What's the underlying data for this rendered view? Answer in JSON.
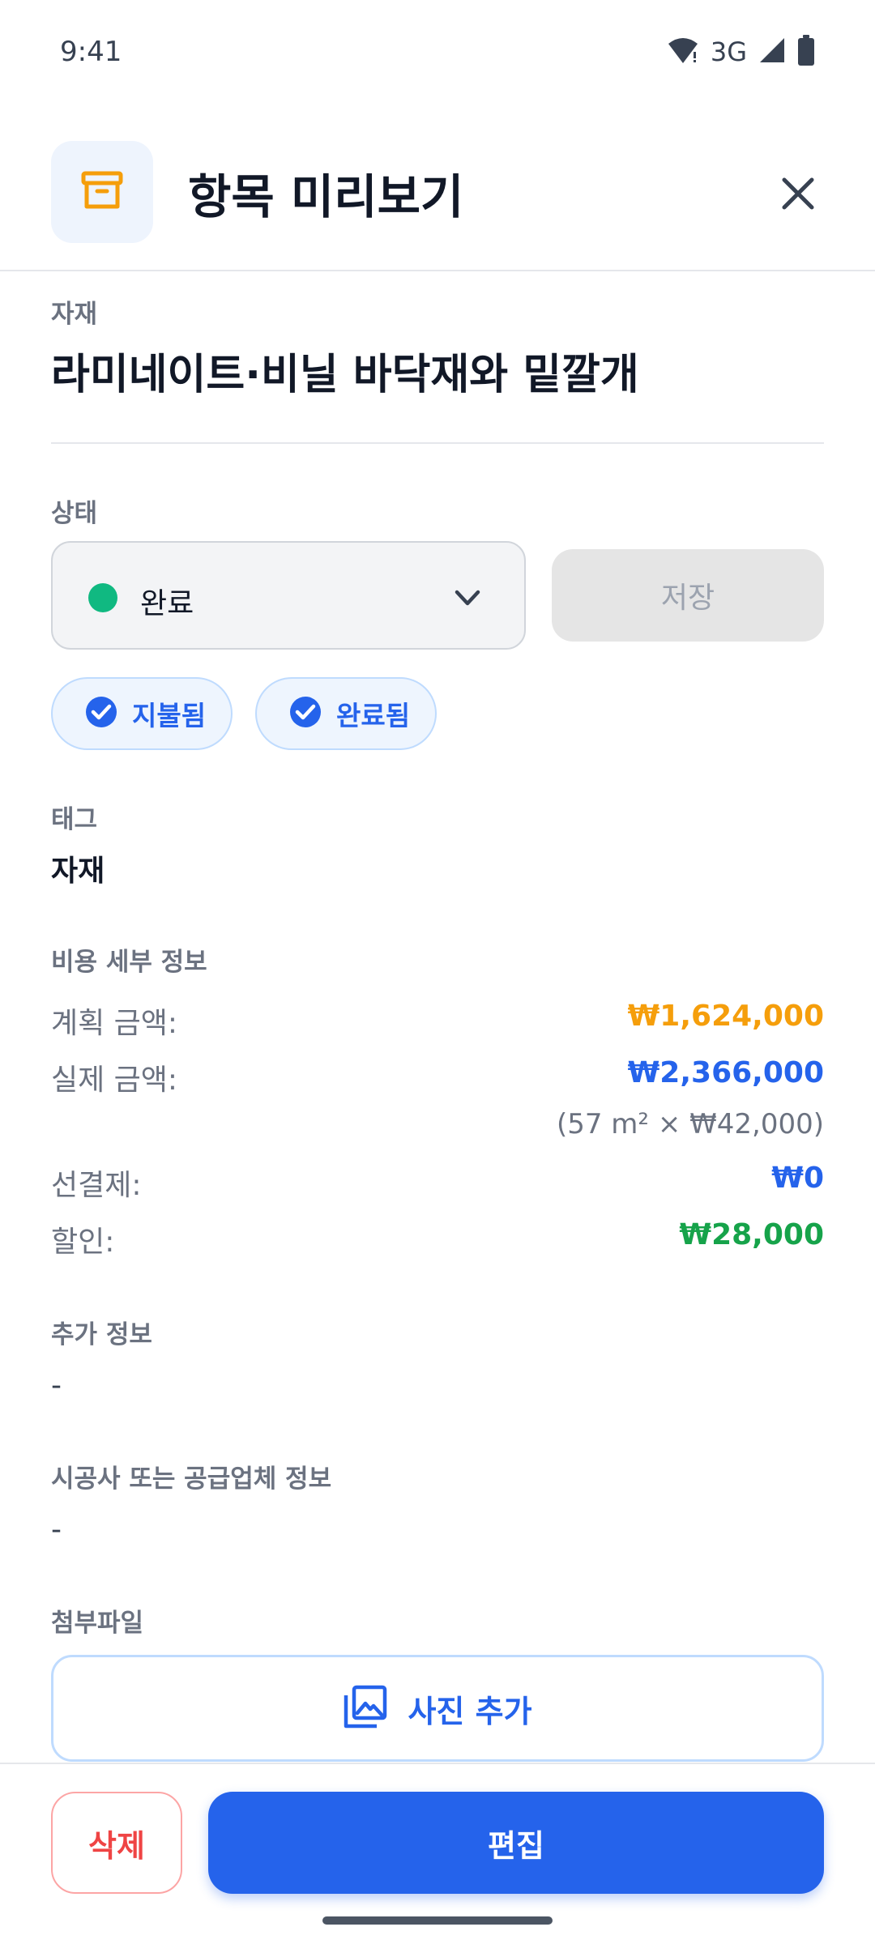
{
  "status_bar": {
    "time": "9:41",
    "network": "3G"
  },
  "header": {
    "title": "항목 미리보기"
  },
  "category": {
    "label": "자재",
    "title": "라미네이트·비닐 바닥재와 밑깔개"
  },
  "status": {
    "label": "상태",
    "value": "완료",
    "save_label": "저장",
    "dot_color": "#10b981"
  },
  "chips": [
    {
      "label": "지불됨"
    },
    {
      "label": "완료됨"
    }
  ],
  "tag": {
    "label": "태그",
    "value": "자재"
  },
  "cost": {
    "label": "비용 세부 정보",
    "planned_label": "계획 금액:",
    "planned_value": "₩1,624,000",
    "actual_label": "실제 금액:",
    "actual_value": "₩2,366,000",
    "calc_note": "(57 m² × ₩42,000)",
    "prepaid_label": "선결제:",
    "prepaid_value": "₩0",
    "discount_label": "할인:",
    "discount_value": "₩28,000",
    "colors": {
      "planned": "#f59e0b",
      "actual": "#2563eb",
      "prepaid": "#2563eb",
      "discount": "#16a34a"
    }
  },
  "extra": {
    "label": "추가 정보",
    "value": "-"
  },
  "contractor": {
    "label": "시공사 또는 공급업체 정보",
    "value": "-"
  },
  "attachments": {
    "label": "첨부파일",
    "add_photo_label": "사진 추가"
  },
  "actions": {
    "delete_label": "삭제",
    "edit_label": "편집"
  },
  "icons": [
    "wifi-icon",
    "signal-icon",
    "battery-icon",
    "archive-box-icon",
    "close-icon",
    "chevron-down-icon",
    "check-circle-icon",
    "photo-library-icon"
  ]
}
